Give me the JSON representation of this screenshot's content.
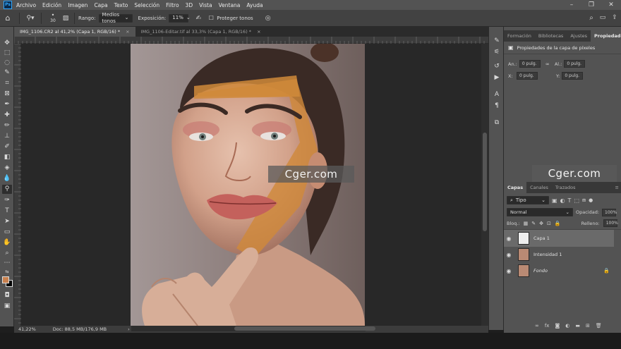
{
  "menu": {
    "logo": "Ps",
    "items": [
      "Archivo",
      "Edición",
      "Imagen",
      "Capa",
      "Texto",
      "Selección",
      "Filtro",
      "3D",
      "Vista",
      "Ventana",
      "Ayuda"
    ]
  },
  "options": {
    "brush_size": "30",
    "range_label": "Rango:",
    "range_value": "Medios tonos",
    "exposure_label": "Exposición:",
    "exposure_value": "11%",
    "protect_label": "Proteger tonos"
  },
  "tabs": [
    {
      "label": "IMG_1106.CR2 al 41,2% (Capa 1, RGB/16) *",
      "active": true
    },
    {
      "label": "IMG_1106-Editar.tif al 33,3% (Capa 1, RGB/16) *",
      "active": false
    }
  ],
  "status": {
    "zoom": "41,22%",
    "doc": "Doc: 88,5 MB/176,9 MB"
  },
  "watermark": {
    "text": "Cger.com"
  },
  "properties_panel": {
    "tabs": [
      "Formación",
      "Bibliotecas",
      "Ajustes",
      "Propiedades"
    ],
    "active_tab": "Propiedades",
    "title": "Propiedades de la capa de píxeles",
    "an_label": "An.:",
    "an_value": "0 pulg.",
    "al_label": "Al.:",
    "al_value": "0 pulg.",
    "x_label": "X:",
    "x_value": "0 pulg.",
    "y_label": "Y:",
    "y_value": "0 pulg."
  },
  "layers_panel": {
    "tabs": [
      "Capas",
      "Canales",
      "Trazados"
    ],
    "filter_value": "Tipo",
    "blend_mode": "Normal",
    "opacity_label": "Opacidad:",
    "opacity_value": "100%",
    "lock_label": "Bloq.:",
    "fill_label": "Relleno:",
    "fill_value": "100%",
    "layers": [
      {
        "name": "Capa 1",
        "selected": true
      },
      {
        "name": "Intensidad 1",
        "selected": false
      },
      {
        "name": "Fondo",
        "selected": false
      }
    ]
  },
  "colors": {
    "foreground": "#c8804e",
    "background": "#000000",
    "accent": "#31a8ff"
  }
}
